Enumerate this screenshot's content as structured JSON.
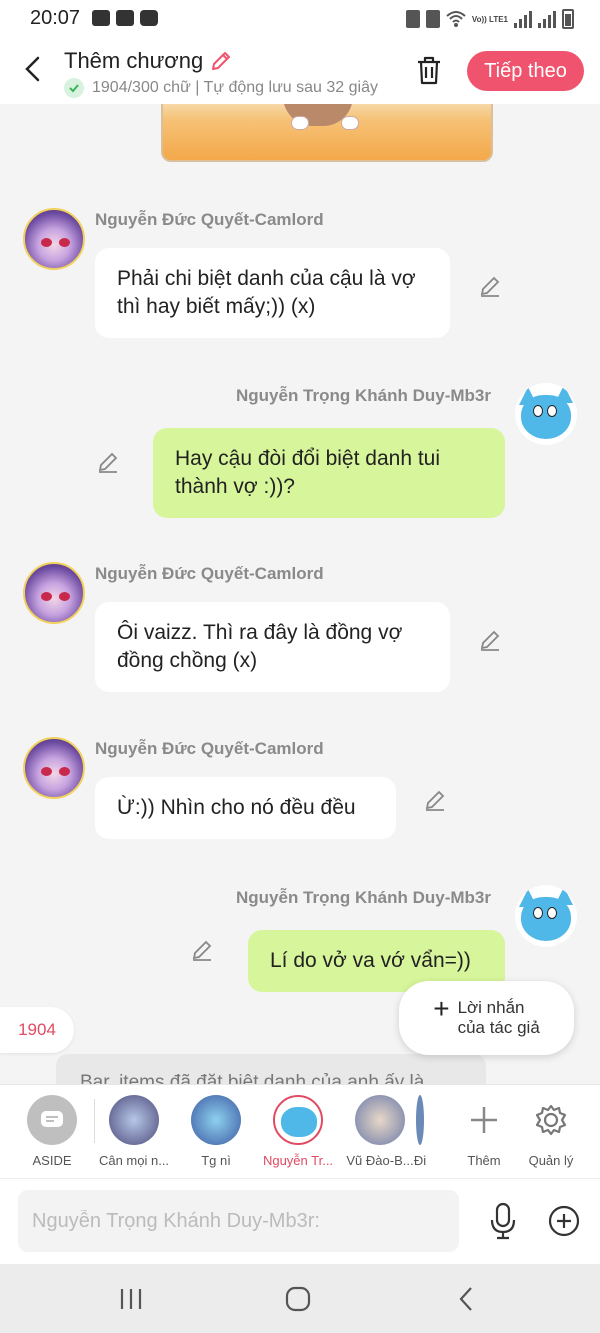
{
  "status_bar": {
    "time": "20:07",
    "volte_label": "Vo)) LTE1",
    "left_icons": [
      "gallery-icon",
      "youtube-icon",
      "screenshot-icon"
    ],
    "right_icons": [
      "alarm-icon",
      "mute-icon",
      "wifi-icon",
      "signal-icon",
      "signal-icon",
      "battery-icon"
    ]
  },
  "header": {
    "title": "Thêm chương",
    "subtitle": "1904/300 chữ | Tự động lưu sau 32 giây",
    "next_button": "Tiếp theo",
    "accent": "#f0536d"
  },
  "messages": [
    {
      "side": "left",
      "name": "Nguyễn Đức Quyết-Camlord",
      "text": "Phải chi biệt danh của cậu là vợ thì hay biết mấy;)) (x)"
    },
    {
      "side": "right",
      "name": "Nguyễn Trọng Khánh Duy-Mb3r",
      "text": "Hay cậu đòi đổi biệt danh tui thành vợ :))?"
    },
    {
      "side": "left",
      "name": "Nguyễn Đức Quyết-Camlord",
      "text": "Ôi vaizz. Thì ra đây là đồng vợ đồng chồng (x)"
    },
    {
      "side": "left",
      "name": "Nguyễn Đức Quyết-Camlord",
      "text": "Ừ:)) Nhìn cho nó đều đều"
    },
    {
      "side": "right",
      "name": "Nguyễn Trọng Khánh Duy-Mb3r",
      "text": "Lí do vở va vớ vẩn=))"
    }
  ],
  "partial_message": "Bar, items đã đặt biệt danh của anh ấy là",
  "count_tag": "1904",
  "author_note": {
    "line1": "Lời nhắn",
    "line2": "của tác giả"
  },
  "character_bar": [
    {
      "label": "ASIDE",
      "active": false
    },
    {
      "label": "Cân mọi n...",
      "active": false
    },
    {
      "label": "Tg nì",
      "active": false
    },
    {
      "label": "Nguyễn Tr...",
      "active": true
    },
    {
      "label": "Vũ Đào-B...",
      "active": false
    },
    {
      "label": "Đi",
      "active": false
    },
    {
      "label": "Thêm",
      "active": false
    },
    {
      "label": "Quản lý",
      "active": false
    }
  ],
  "input": {
    "placeholder": "Nguyễn Trọng Khánh Duy-Mb3r:"
  },
  "colors": {
    "bubble_green": "#d7f59a",
    "bubble_white": "#ffffff",
    "active_tab": "#e04a62"
  }
}
